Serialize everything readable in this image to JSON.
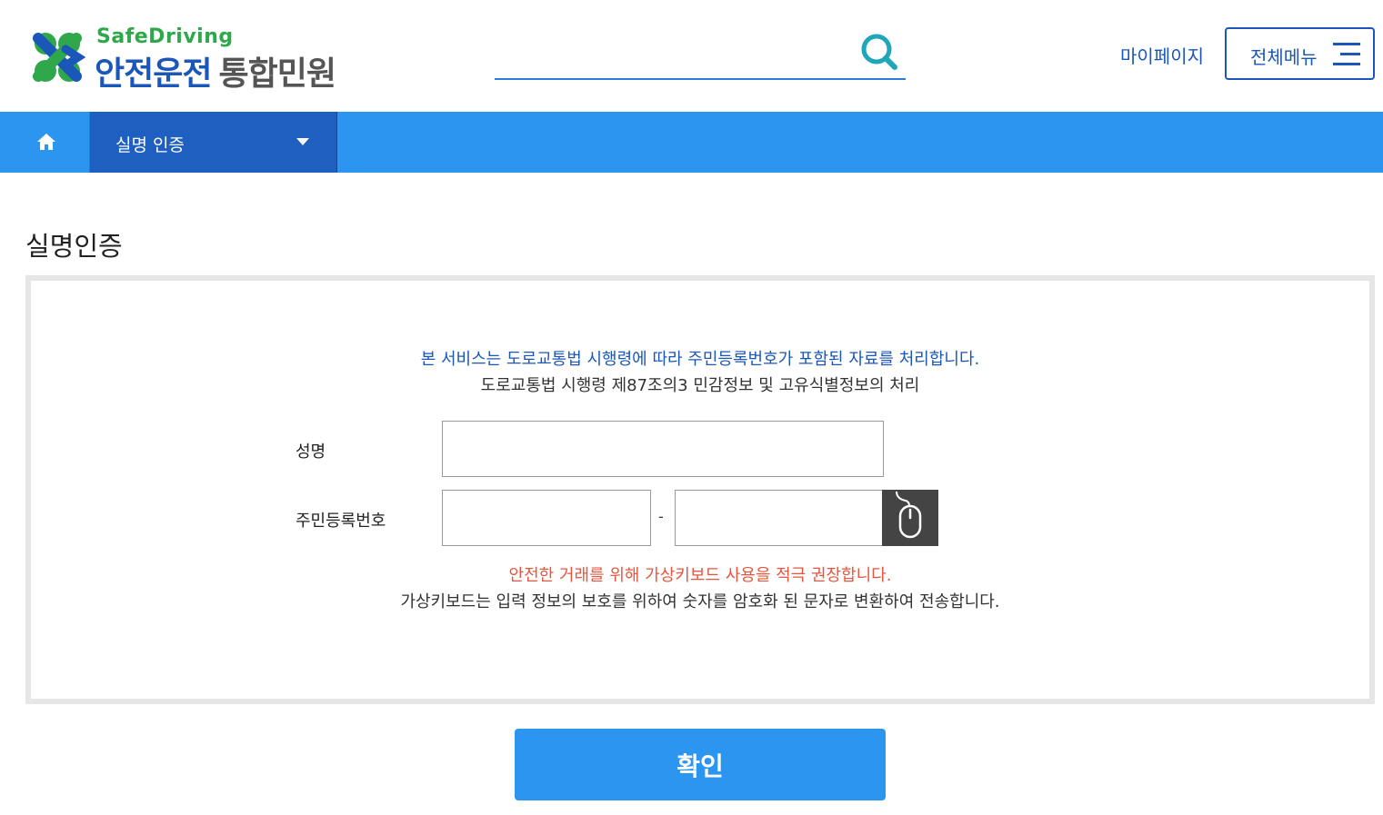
{
  "header": {
    "logo_en": "SafeDriving",
    "logo_ko": "안전운전",
    "logo_sub": "통합민원",
    "search": {
      "placeholder": "",
      "value": "",
      "icon": "search-icon"
    },
    "mypage_label": "마이페이지",
    "allmenu_label": "전체메뉴"
  },
  "nav": {
    "home_icon": "home-icon",
    "crumb_label": "실명 인증"
  },
  "page": {
    "title": "실명인증"
  },
  "form": {
    "notice_primary": "본 서비스는 도로교통법 시행령에 따라 주민등록번호가 포함된 자료를 처리합니다.",
    "notice_secondary": "도로교통법 시행령 제87조의3 민감정보 및 고유식별정보의 처리",
    "name_label": "성명",
    "name_value": "",
    "rrn_label": "주민등록번호",
    "rrn_front_value": "",
    "rrn_separator": "-",
    "rrn_back_value": "",
    "virtual_keyboard_icon": "mouse-icon",
    "warning_primary": "안전한 거래를 위해 가상키보드 사용을 적극 권장합니다.",
    "warning_secondary": "가상키보드는 입력 정보의 보호를 위하여 숫자를 암호화 된 문자로 변환하여 전송합니다."
  },
  "actions": {
    "confirm_label": "확인"
  },
  "colors": {
    "brand_blue": "#1a57b8",
    "nav_blue": "#2b95f0",
    "nav_dark": "#1f5fbf",
    "logo_green": "#2ea84a",
    "warning_red": "#e8553e"
  }
}
